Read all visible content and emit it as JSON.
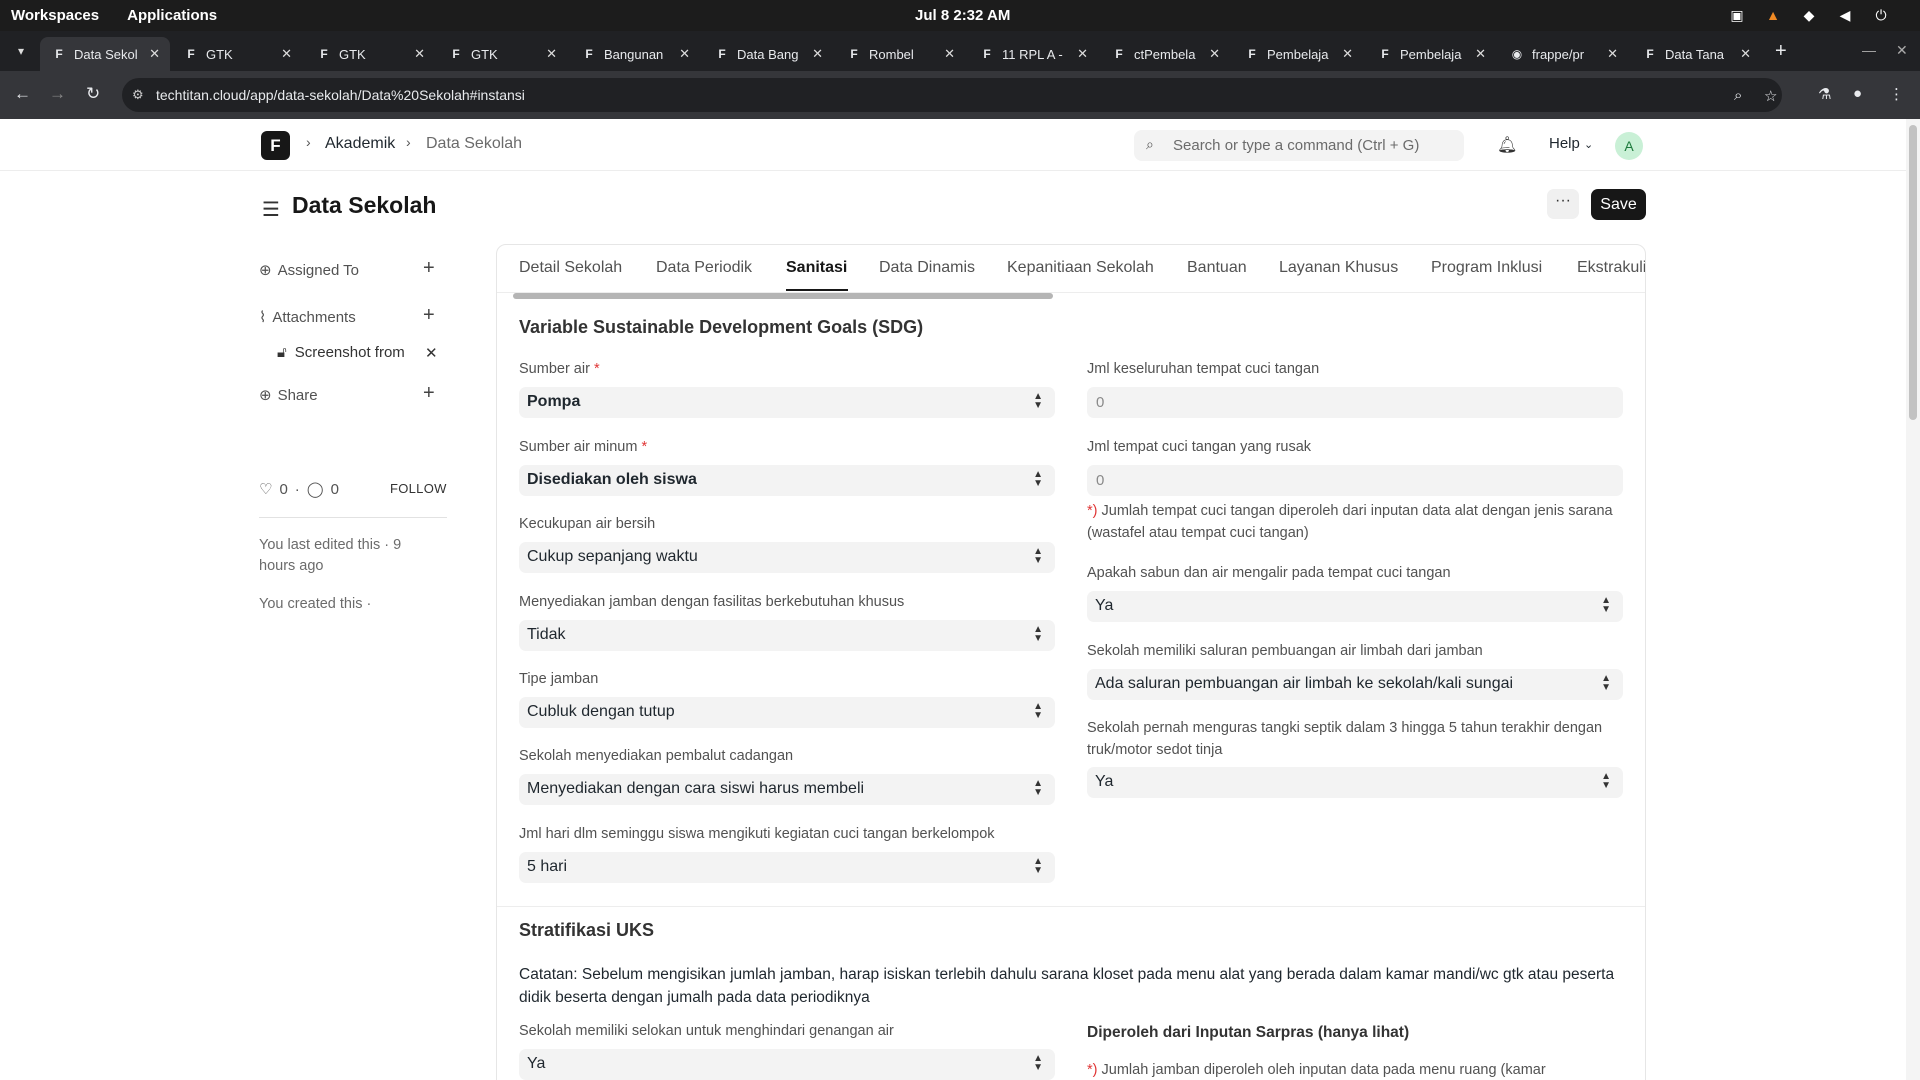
{
  "os": {
    "workspaces": "Workspaces",
    "applications": "Applications",
    "clock": "Jul 8  2:32 AM"
  },
  "browser": {
    "tabs": [
      {
        "label": "Data Sekol",
        "fav": "F"
      },
      {
        "label": "GTK",
        "fav": "F"
      },
      {
        "label": "GTK",
        "fav": "F"
      },
      {
        "label": "GTK",
        "fav": "F"
      },
      {
        "label": "Bangunan",
        "fav": "F"
      },
      {
        "label": "Data Bang",
        "fav": "F"
      },
      {
        "label": "Rombel",
        "fav": "F"
      },
      {
        "label": "11 RPL A -",
        "fav": "F"
      },
      {
        "label": "ctPembela",
        "fav": "F"
      },
      {
        "label": "Pembelaja",
        "fav": "F"
      },
      {
        "label": "Pembelaja",
        "fav": "F"
      },
      {
        "label": "frappe/pr",
        "fav": "◉"
      },
      {
        "label": "Data Tana",
        "fav": "F"
      }
    ],
    "url": "techtitan.cloud/app/data-sekolah/Data%20Sekolah#instansi"
  },
  "navbar": {
    "logo": "F",
    "breadcrumb": [
      "Akademik",
      "Data Sekolah"
    ],
    "search_placeholder": "Search or type a command (Ctrl + G)",
    "help": "Help",
    "avatar": "A"
  },
  "page": {
    "title": "Data Sekolah",
    "more": "···",
    "save": "Save"
  },
  "sidebar": {
    "assigned_to": "Assigned To",
    "attachments": "Attachments",
    "attachment_file": "Screenshot from",
    "share": "Share",
    "likes": "0",
    "comments": "0",
    "follow": "FOLLOW",
    "last_edited": "You last edited this · 9 hours ago",
    "created": "You created this ·"
  },
  "tabs": [
    "Detail Sekolah",
    "Data Periodik",
    "Sanitasi",
    "Data Dinamis",
    "Kepanitiaan Sekolah",
    "Bantuan",
    "Layanan Khusus",
    "Program Inklusi",
    "Ekstrakuli"
  ],
  "active_tab": "Sanitasi",
  "sdg": {
    "title": "Variable Sustainable Development Goals (SDG)",
    "left": [
      {
        "label": "Sumber air",
        "required": "*",
        "value": "Pompa"
      },
      {
        "label": "Sumber air minum",
        "required": "*",
        "value": "Disediakan oleh siswa"
      },
      {
        "label": "Kecukupan air bersih",
        "value": "Cukup sepanjang waktu"
      },
      {
        "label": "Menyediakan jamban dengan fasilitas berkebutuhan khusus",
        "value": "Tidak"
      },
      {
        "label": "Tipe jamban",
        "value": "Cubluk dengan tutup"
      },
      {
        "label": "Sekolah menyediakan pembalut cadangan",
        "value": "Menyediakan dengan cara siswi harus membeli"
      },
      {
        "label": "Jml hari dlm seminggu siswa mengikuti kegiatan cuci tangan berkelompok",
        "value": "5 hari"
      }
    ],
    "right": {
      "cuci_total_label": "Jml keseluruhan tempat cuci tangan",
      "cuci_total_value": "0",
      "cuci_rusak_label": "Jml tempat cuci tangan yang rusak",
      "cuci_rusak_value": "0",
      "note_star": "*)",
      "note": "Jumlah tempat cuci tangan diperoleh dari inputan data alat dengan jenis sarana (wastafel atau tempat cuci tangan)",
      "sabun_label": "Apakah sabun dan air mengalir pada tempat cuci tangan",
      "sabun_value": "Ya",
      "saluran_label": "Sekolah memiliki saluran pembuangan air limbah dari jamban",
      "saluran_value": "Ada saluran pembuangan air limbah ke sekolah/kali sungai",
      "septik_label": "Sekolah pernah menguras tangki septik dalam 3 hingga 5 tahun terakhir dengan truk/motor sedot tinja",
      "septik_value": "Ya"
    }
  },
  "uks": {
    "title": "Stratifikasi UKS",
    "catatan": "Catatan: Sebelum mengisikan jumlah jamban, harap isiskan terlebih dahulu sarana kloset pada menu alat yang berada dalam kamar mandi/wc gtk atau peserta didik beserta dengan jumalh pada data periodiknya",
    "selokan_label": "Sekolah memiliki selokan untuk menghindari genangan air",
    "selokan_value": "Ya",
    "sarpras_label": "Diperoleh dari Inputan Sarpras (hanya lihat)",
    "jamban_note_star": "*)",
    "jamban_note": "Jumlah jamban diperoleh oleh inputan data pada menu ruang (kamar"
  }
}
